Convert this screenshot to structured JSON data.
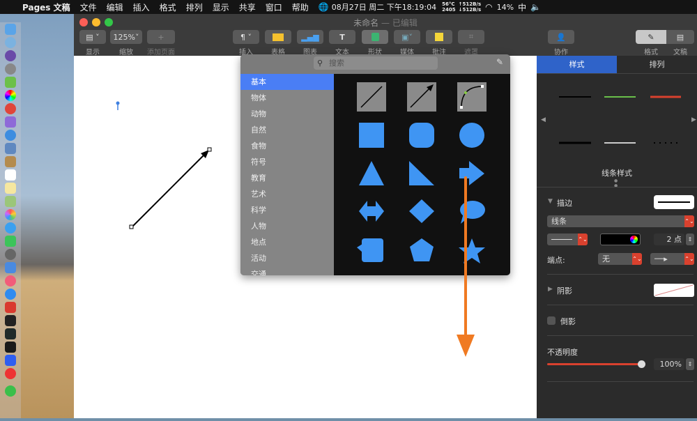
{
  "menubar": {
    "app": "Pages 文稿",
    "items": [
      "文件",
      "编辑",
      "插入",
      "格式",
      "排列",
      "显示",
      "共享",
      "窗口",
      "帮助"
    ],
    "datetime": "08月27日 周二 下午18:19:04",
    "temp": "56°C",
    "fan": "2405",
    "net_up": "↑512B/s",
    "net_down": "↓512B/s",
    "battery": "14%",
    "input": "中"
  },
  "window": {
    "title": "未命名",
    "subtitle": "— 已编辑"
  },
  "toolbar": {
    "zoom": "125%",
    "labels": {
      "view": "显示",
      "zoom": "缩放",
      "add_page": "添加页面",
      "insert": "插入",
      "table": "表格",
      "chart": "图表",
      "text": "文本",
      "shape": "形状",
      "media": "媒体",
      "comment": "批注",
      "crop": "遮罩",
      "collab": "协作",
      "format": "格式",
      "document": "文稿"
    }
  },
  "shape_popup": {
    "search_placeholder": "搜索",
    "categories": [
      "基本",
      "物体",
      "动物",
      "自然",
      "食物",
      "符号",
      "教育",
      "艺术",
      "科学",
      "人物",
      "地点",
      "活动",
      "交通"
    ],
    "selected": "基本"
  },
  "inspector": {
    "tabs": [
      "样式",
      "排列"
    ],
    "line_styles_label": "线条样式",
    "stroke": {
      "label": "描边",
      "type": "线条",
      "width": "2 点",
      "endpoints_label": "端点:",
      "start": "无"
    },
    "shadow": "阴影",
    "reflection": "倒影",
    "opacity": {
      "label": "不透明度",
      "value": "100%",
      "fraction": 1.0
    }
  },
  "colors": {
    "accent": "#2f63c9",
    "shape": "#3f95f3",
    "annotation": "#f07a22"
  }
}
